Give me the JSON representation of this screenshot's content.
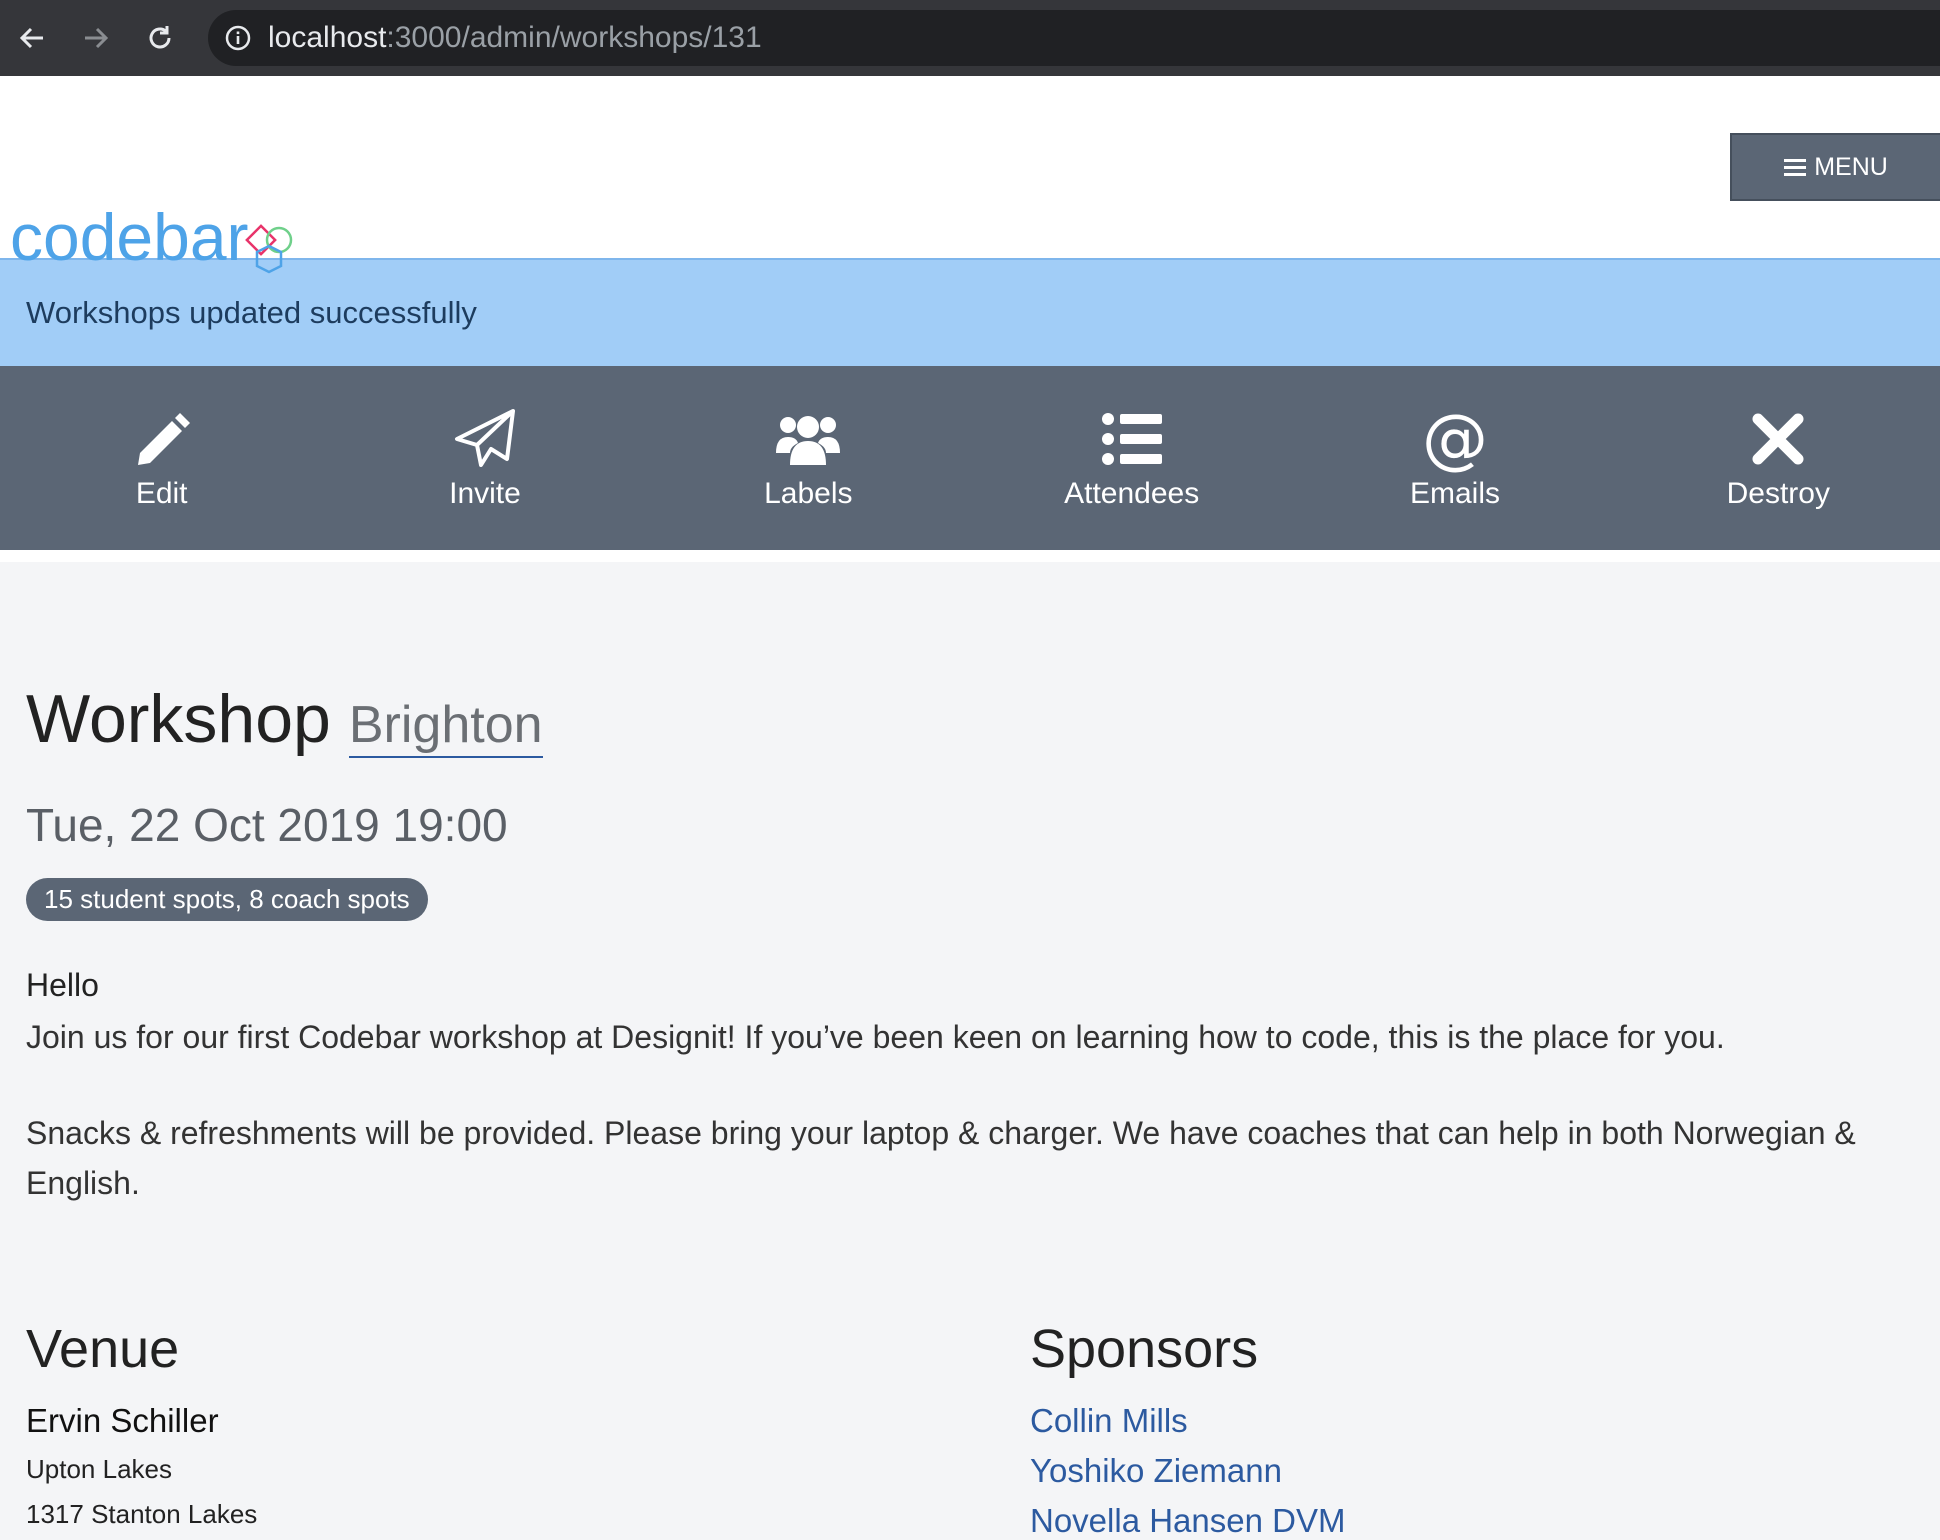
{
  "browser": {
    "url_host": "localhost",
    "url_rest": ":3000/admin/workshops/131"
  },
  "header": {
    "logo_text": "codebar",
    "menu_label": "MENU"
  },
  "flash": {
    "message": "Workshops updated successfully"
  },
  "toolbar": {
    "items": [
      {
        "label": "Edit",
        "icon": "pencil-icon"
      },
      {
        "label": "Invite",
        "icon": "paper-plane-icon"
      },
      {
        "label": "Labels",
        "icon": "users-icon"
      },
      {
        "label": "Attendees",
        "icon": "list-icon"
      },
      {
        "label": "Emails",
        "icon": "at-icon"
      },
      {
        "label": "Destroy",
        "icon": "close-icon"
      }
    ]
  },
  "workshop": {
    "title": "Workshop",
    "chapter": "Brighton",
    "date": "Tue, 22 Oct 2019 19:00",
    "spots": "15 student spots, 8 coach spots",
    "greeting": "Hello",
    "description_1": "Join us for our first Codebar workshop at Designit! If you’ve been keen on learning how to code, this is the place for you.",
    "description_2": "Snacks & refreshments will be provided. Please bring your laptop & charger. We have coaches that can help in both Norwegian & English."
  },
  "venue": {
    "heading": "Venue",
    "name": "Ervin Schiller",
    "address_1": "Upton Lakes",
    "address_2": "1317 Stanton Lakes"
  },
  "sponsors": {
    "heading": "Sponsors",
    "items": [
      "Collin Mills",
      "Yoshiko Ziemann",
      "Novella Hansen DVM"
    ]
  },
  "colors": {
    "toolbar": "#5b6675",
    "flash": "#a1cdf7",
    "link": "#2c5aa0",
    "logo": "#4ea3e8"
  }
}
